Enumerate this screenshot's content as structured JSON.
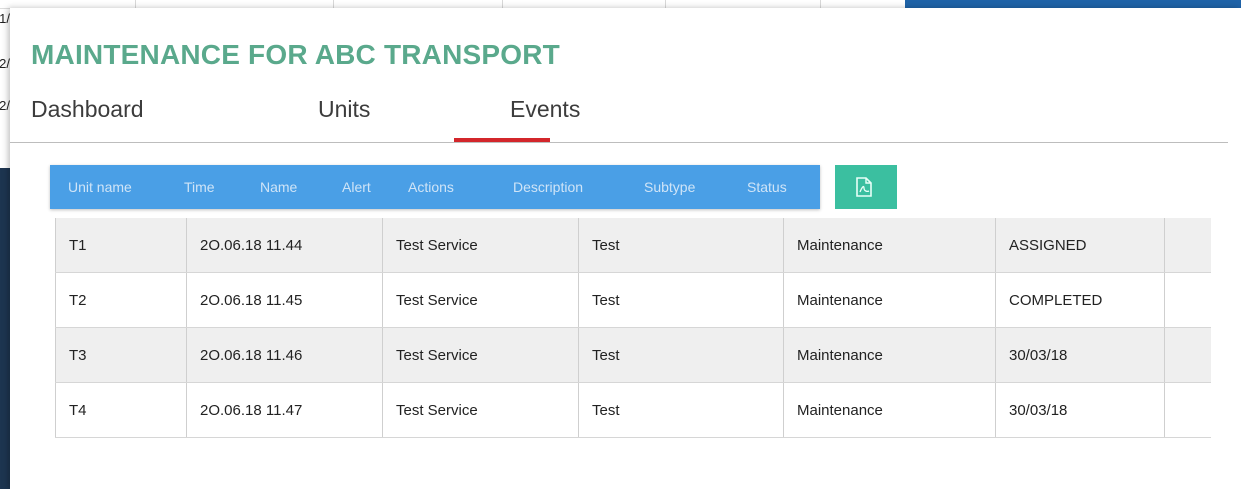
{
  "background": {
    "left_fragments": [
      "/1",
      "/2",
      "/2"
    ]
  },
  "title": "MAINTENANCE FOR ABC TRANSPORT",
  "tabs": [
    {
      "label": "Dashboard"
    },
    {
      "label": "Units"
    },
    {
      "label": "Events",
      "active": true
    }
  ],
  "table_header": {
    "columns": [
      "Unit name",
      "Time",
      "Name",
      "Alert",
      "Actions",
      "Description",
      "Subtype",
      "Status"
    ],
    "export_icon": "pdf-icon"
  },
  "rows": [
    {
      "unit": "T1",
      "time": "2O.06.18 11.44",
      "name": "Test Service",
      "alert": "Test",
      "type": "Maintenance",
      "status": "ASSIGNED"
    },
    {
      "unit": "T2",
      "time": "2O.06.18 11.45",
      "name": "Test Service",
      "alert": "Test",
      "type": "Maintenance",
      "status": "COMPLETED"
    },
    {
      "unit": "T3",
      "time": "2O.06.18 11.46",
      "name": "Test Service",
      "alert": "Test",
      "type": "Maintenance",
      "status": "30/03/18"
    },
    {
      "unit": "T4",
      "time": "2O.06.18 11.47",
      "name": "Test Service",
      "alert": "Test",
      "type": "Maintenance",
      "status": "30/03/18"
    }
  ],
  "colors": {
    "title": "#5aa98c",
    "header_bar": "#4a9fe6",
    "export_button": "#3bbfa0",
    "active_tab_indicator": "#d3262b"
  }
}
